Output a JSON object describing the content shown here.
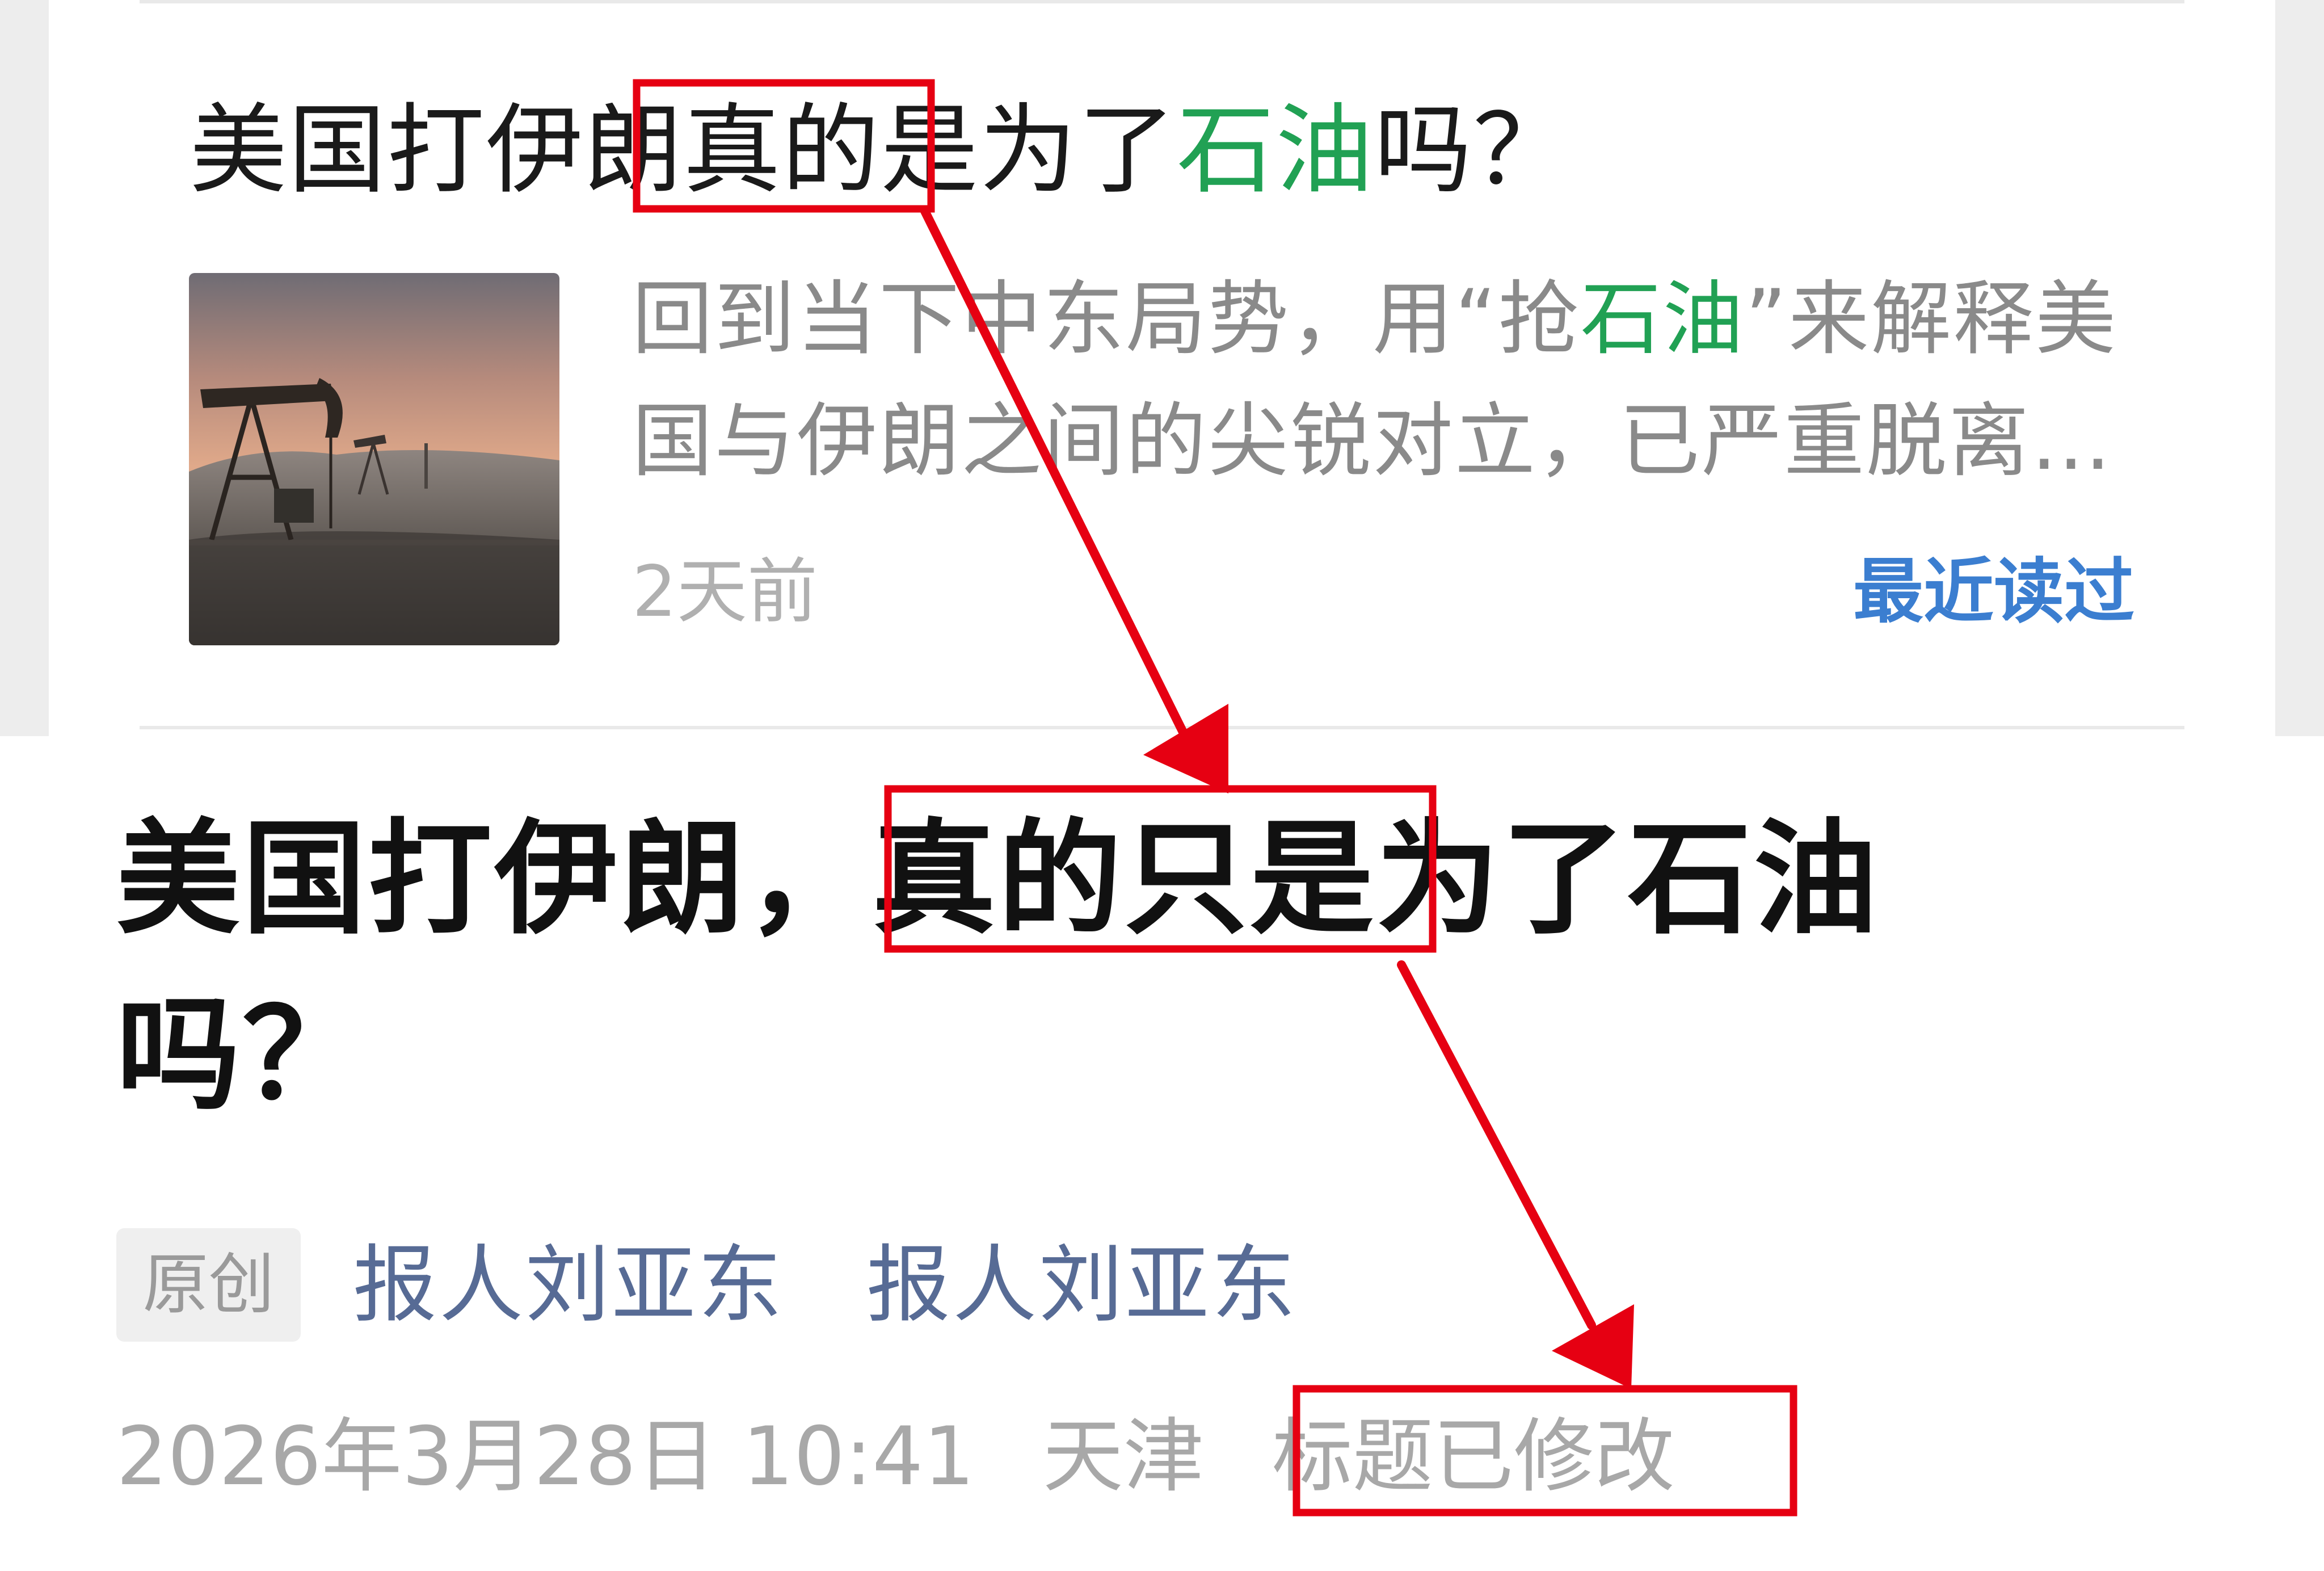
{
  "search_result": {
    "title_parts": [
      "美国打伊朗",
      "真的是",
      "为了",
      "石油",
      "吗？"
    ],
    "summary_line1_a": "回到当下中东局势，用“抢",
    "summary_line1_keyword": "石油",
    "summary_line1_b": "”来解释美",
    "summary_line2": "国与伊朗之间的尖锐对立，已严重脱离…",
    "time": "2天前",
    "recent_label": "最近读过"
  },
  "article": {
    "title_line1_a": "美国打伊朗，",
    "title_line1_highlight": "真的只是",
    "title_line1_b": "为了石油",
    "title_line2": "吗？",
    "original_badge": "原创",
    "author": "报人刘亚东",
    "account": "报人刘亚东",
    "date_time": "2026年3月28日 10:41",
    "location": "天津",
    "title_modified": "标题已修改"
  },
  "annotation": {
    "color": "#e60012"
  },
  "colors": {
    "keyword_green": "#21a154",
    "link_blue": "#3b7ed0",
    "account_blue": "#576b95"
  },
  "icons": {
    "thumbnail": "oil-pumpjack-image"
  }
}
